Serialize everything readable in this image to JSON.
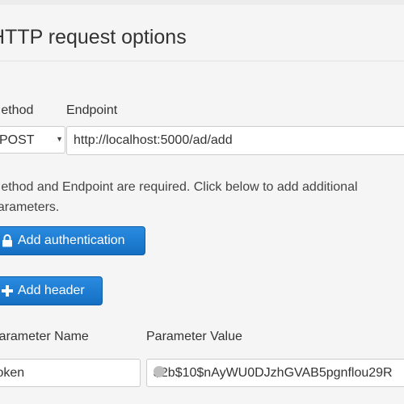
{
  "page": {
    "title": "HTTP request options"
  },
  "form": {
    "method_label": "Method",
    "endpoint_label": "Endpoint",
    "method_value": "POST",
    "endpoint_value": "http://localhost:5000/ad/add",
    "help_text": "Method and Endpoint are required. Click below to add additional parameters.",
    "add_auth_label": "Add authentication",
    "add_header_label": "Add header",
    "param_name_label": "Parameter Name",
    "param_value_label": "Parameter Value",
    "param_name_value": "token",
    "param_value_value": "$2b$10$nAyWU0DJzhGVAB5pgnflou29R"
  },
  "colors": {
    "accent": "#1a7ad0",
    "background": "#f5f5f5"
  },
  "icons": {
    "auth": "lock-icon",
    "header": "plus-icon"
  }
}
